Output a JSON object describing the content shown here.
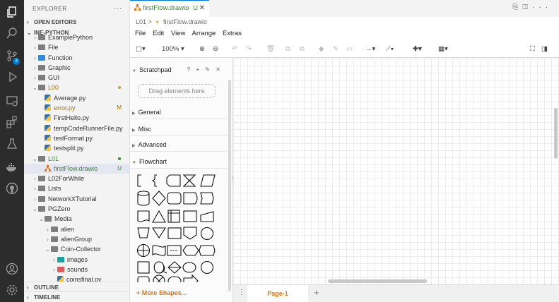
{
  "sidebar": {
    "header": "EXPLORER",
    "open_editors": "OPEN EDITORS",
    "workspace": "INE-PYTHON",
    "outline": "OUTLINE",
    "timeline": "TIMELINE",
    "tree": [
      {
        "label": "ExamplePython",
        "indent": 1,
        "chev": "›",
        "icon": "folder"
      },
      {
        "label": "File",
        "indent": 1,
        "chev": "›",
        "icon": "folder"
      },
      {
        "label": "Function",
        "indent": 1,
        "chev": "›",
        "icon": "folder-blue"
      },
      {
        "label": "Graphic",
        "indent": 1,
        "chev": "›",
        "icon": "folder"
      },
      {
        "label": "GUI",
        "indent": 1,
        "chev": "›",
        "icon": "folder"
      },
      {
        "label": "L00",
        "indent": 1,
        "chev": "⌄",
        "icon": "folder",
        "cls": "mod",
        "dot": "#c9a13b"
      },
      {
        "label": "Average.py",
        "indent": 2,
        "chev": "",
        "icon": "py"
      },
      {
        "label": "error.py",
        "indent": 2,
        "chev": "",
        "icon": "py",
        "cls": "mod",
        "status": "M"
      },
      {
        "label": "FirstHello.py",
        "indent": 2,
        "chev": "",
        "icon": "py"
      },
      {
        "label": "tempCodeRunnerFile.py",
        "indent": 2,
        "chev": "",
        "icon": "py"
      },
      {
        "label": "testFormat.py",
        "indent": 2,
        "chev": "",
        "icon": "py"
      },
      {
        "label": "testsplit.py",
        "indent": 2,
        "chev": "",
        "icon": "py"
      },
      {
        "label": "L01",
        "indent": 1,
        "chev": "⌄",
        "icon": "folder",
        "cls": "grn",
        "dot": "#388a34"
      },
      {
        "label": "firstFlow.drawio",
        "indent": 2,
        "chev": "",
        "icon": "drawio",
        "cls": "grn",
        "status": "U",
        "sel": true
      },
      {
        "label": "L02ForWhile",
        "indent": 1,
        "chev": "›",
        "icon": "folder"
      },
      {
        "label": "Lists",
        "indent": 1,
        "chev": "›",
        "icon": "folder"
      },
      {
        "label": "NetworkXTutorial",
        "indent": 1,
        "chev": "›",
        "icon": "folder"
      },
      {
        "label": "PGZero",
        "indent": 1,
        "chev": "⌄",
        "icon": "folder"
      },
      {
        "label": "Media",
        "indent": 2,
        "chev": "⌄",
        "icon": "folder"
      },
      {
        "label": "alien",
        "indent": 3,
        "chev": "›",
        "icon": "folder"
      },
      {
        "label": "alienGroup",
        "indent": 3,
        "chev": "›",
        "icon": "folder"
      },
      {
        "label": "Coin-Collector",
        "indent": 3,
        "chev": "⌄",
        "icon": "folder"
      },
      {
        "label": "images",
        "indent": 4,
        "chev": "›",
        "icon": "folder-teal"
      },
      {
        "label": "sounds",
        "indent": 4,
        "chev": "›",
        "icon": "folder-red"
      },
      {
        "label": "coinsfinal.py",
        "indent": 4,
        "chev": "",
        "icon": "py"
      }
    ]
  },
  "editor": {
    "tab_label": "firstFlow.drawio",
    "tab_status": "U",
    "breadcrumb": "L01 > 🔸 firstFlow.drawio",
    "menu": [
      "File",
      "Edit",
      "View",
      "Arrange",
      "Extras"
    ],
    "zoom": "100%"
  },
  "panel": {
    "scratchpad": "Scratchpad",
    "drag_hint": "Drag elements here",
    "sections": [
      "General",
      "Misc",
      "Advanced",
      "Flowchart"
    ],
    "more_shapes": "+ More Shapes..."
  },
  "pages": {
    "current": "Page-1"
  },
  "colors": {
    "accent": "#0078d4",
    "drawio_orange": "#e0781a",
    "git_modified": "#a57500",
    "git_untracked": "#388a34"
  }
}
